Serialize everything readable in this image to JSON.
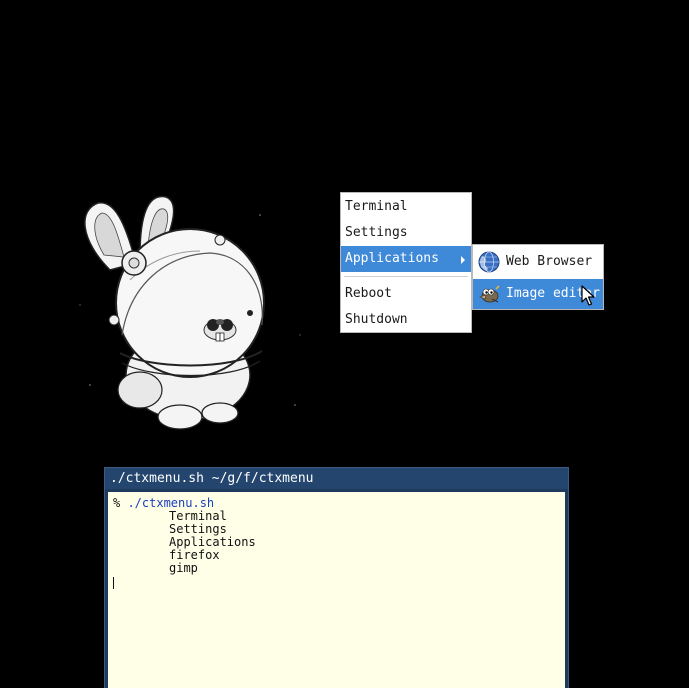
{
  "context_menu": {
    "items": [
      {
        "label": "Terminal"
      },
      {
        "label": "Settings"
      },
      {
        "label": "Applications",
        "has_submenu": true,
        "active": true
      },
      {
        "label": "Reboot"
      },
      {
        "label": "Shutdown"
      }
    ],
    "accent_color": "#3f89d9"
  },
  "submenu": {
    "items": [
      {
        "label": "Web Browser",
        "icon": "globe-icon"
      },
      {
        "label": "Image editor",
        "icon": "gimp-icon",
        "active": true
      }
    ]
  },
  "terminal": {
    "title": "./ctxmenu.sh ~/g/f/ctxmenu",
    "prompt": "% ",
    "command": "./ctxmenu.sh",
    "output": [
      "Terminal",
      "Settings",
      "Applications",
      "firefox",
      "gimp"
    ],
    "background": "#ffffe8"
  }
}
